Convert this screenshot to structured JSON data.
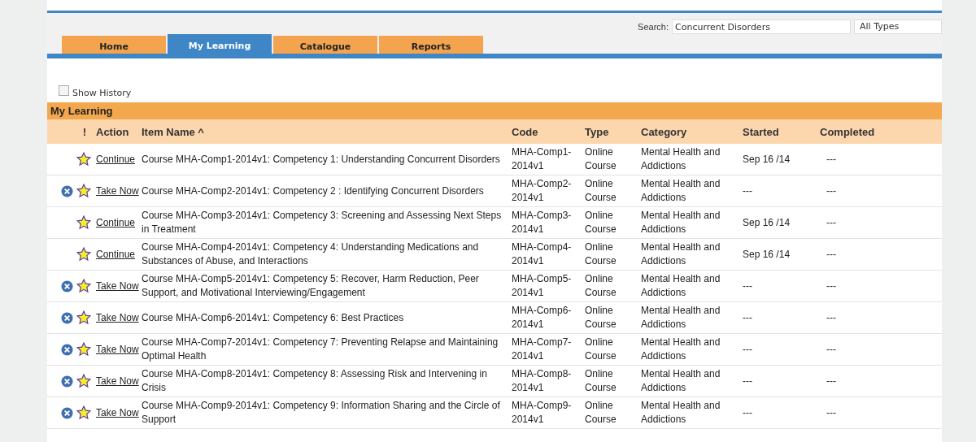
{
  "search": {
    "label": "Search:",
    "value": "Concurrent Disorders",
    "type_filter": "All Types"
  },
  "tabs": [
    {
      "label": "Home",
      "selected": false
    },
    {
      "label": "My Learning",
      "selected": true
    },
    {
      "label": "Catalogue",
      "selected": false
    },
    {
      "label": "Reports",
      "selected": false
    }
  ],
  "show_history": {
    "label": "Show History",
    "checked": false
  },
  "section_title": "My Learning",
  "table": {
    "columns": [
      "!",
      "Action",
      "Item Name ^",
      "Code",
      "Type",
      "Category",
      "Started",
      "Completed"
    ],
    "rows": [
      {
        "removable": false,
        "action": "Continue",
        "item_name": "Course MHA-Comp1-2014v1: Competency 1: Understanding Concurrent Disorders",
        "code": "MHA-Comp1-2014v1",
        "type": "Online Course",
        "category": "Mental Health and Addictions",
        "started": "Sep 16 /14",
        "completed": "---"
      },
      {
        "removable": true,
        "action": "Take Now",
        "item_name": "Course MHA-Comp2-2014v1: Competency 2 : Identifying Concurrent Disorders",
        "code": "MHA-Comp2-2014v1",
        "type": "Online Course",
        "category": "Mental Health and Addictions",
        "started": "---",
        "completed": "---"
      },
      {
        "removable": false,
        "action": "Continue",
        "item_name": "Course MHA-Comp3-2014v1: Competency 3: Screening and Assessing Next Steps in Treatment",
        "code": "MHA-Comp3-2014v1",
        "type": "Online Course",
        "category": "Mental Health and Addictions",
        "started": "Sep 16 /14",
        "completed": "---"
      },
      {
        "removable": false,
        "action": "Continue",
        "item_name": "Course MHA-Comp4-2014v1: Competency 4: Understanding Medications and Substances of Abuse, and Interactions",
        "code": "MHA-Comp4-2014v1",
        "type": "Online Course",
        "category": "Mental Health and Addictions",
        "started": "Sep 16 /14",
        "completed": "---"
      },
      {
        "removable": true,
        "action": "Take Now",
        "item_name": "Course MHA-Comp5-2014v1: Competency 5: Recover, Harm Reduction, Peer Support, and Motivational Interviewing/Engagement",
        "code": "MHA-Comp5-2014v1",
        "type": "Online Course",
        "category": "Mental Health and Addictions",
        "started": "---",
        "completed": "---"
      },
      {
        "removable": true,
        "action": "Take Now",
        "item_name": "Course MHA-Comp6-2014v1: Competency 6: Best Practices",
        "code": "MHA-Comp6-2014v1",
        "type": "Online Course",
        "category": "Mental Health and Addictions",
        "started": "---",
        "completed": "---"
      },
      {
        "removable": true,
        "action": "Take Now",
        "item_name": "Course MHA-Comp7-2014v1: Competency 7: Preventing Relapse and Maintaining Optimal Health",
        "code": "MHA-Comp7-2014v1",
        "type": "Online Course",
        "category": "Mental Health and Addictions",
        "started": "---",
        "completed": "---"
      },
      {
        "removable": true,
        "action": "Take Now",
        "item_name": "Course MHA-Comp8-2014v1: Competency 8: Assessing Risk and Intervening in Crisis",
        "code": "MHA-Comp8-2014v1",
        "type": "Online Course",
        "category": "Mental Health and Addictions",
        "started": "---",
        "completed": "---"
      },
      {
        "removable": true,
        "action": "Take Now",
        "item_name": "Course MHA-Comp9-2014v1: Competency 9: Information Sharing and the Circle of Support",
        "code": "MHA-Comp9-2014v1",
        "type": "Online Course",
        "category": "Mental Health and Addictions",
        "started": "---",
        "completed": "---"
      }
    ]
  }
}
